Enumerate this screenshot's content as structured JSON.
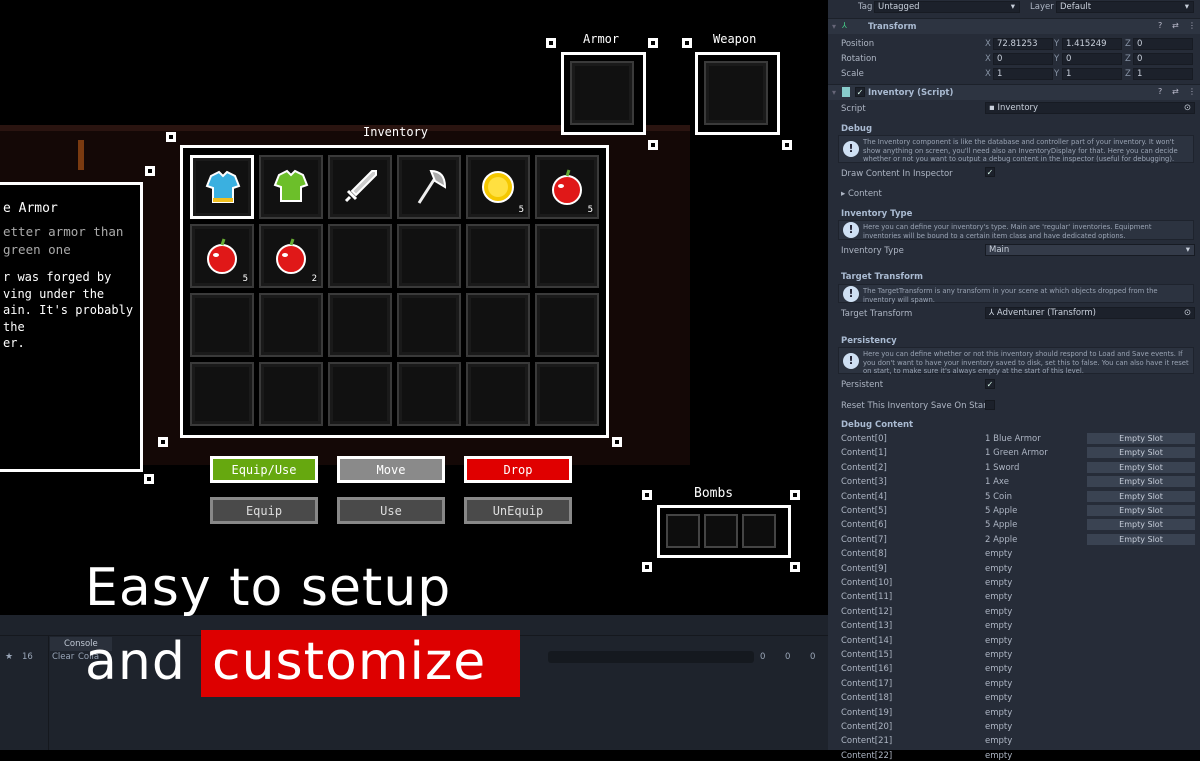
{
  "game": {
    "inventory_title": "Inventory",
    "armor_title": "Armor",
    "weapon_title": "Weapon",
    "bombs_title": "Bombs",
    "description": {
      "title": "e Armor",
      "short": [
        "etter armor than",
        "green one"
      ],
      "long": [
        "r was forged by",
        "ving under the",
        "ain. It's probably the",
        "er."
      ]
    },
    "slots": [
      {
        "icon": "blue-armor-icon",
        "count": ""
      },
      {
        "icon": "green-armor-icon",
        "count": ""
      },
      {
        "icon": "sword-icon",
        "count": ""
      },
      {
        "icon": "axe-icon",
        "count": ""
      },
      {
        "icon": "coin-icon",
        "count": "5"
      },
      {
        "icon": "apple-icon",
        "count": "5"
      },
      {
        "icon": "apple-icon",
        "count": "5"
      },
      {
        "icon": "apple-icon",
        "count": "2"
      }
    ],
    "buttons": {
      "equip_use": "Equip/Use",
      "move": "Move",
      "drop": "Drop",
      "equip": "Equip",
      "use": "Use",
      "unequip": "UnEquip"
    },
    "colors": {
      "equip_use": "#66a80f",
      "move": "#8a8a8a",
      "drop": "#e00000",
      "highlight": "#dd0000"
    }
  },
  "overlay": {
    "line1": "Easy to setup",
    "line2_plain": "and",
    "line2_highlight": "customize"
  },
  "console": {
    "tab": "Console",
    "clear": "Clear",
    "collapse": "Colla",
    "hidden_count": "16",
    "errors": "0",
    "warnings": "0",
    "logs": "0"
  },
  "inspector": {
    "tag_label": "Tag",
    "tag_value": "Untagged",
    "layer_label": "Layer",
    "layer_value": "Default",
    "transform": {
      "title": "Transform",
      "rows": [
        {
          "label": "Position",
          "x": "72.81253",
          "y": "1.415249",
          "z": "0"
        },
        {
          "label": "Rotation",
          "x": "0",
          "y": "0",
          "z": "0"
        },
        {
          "label": "Scale",
          "x": "1",
          "y": "1",
          "z": "1"
        }
      ]
    },
    "script_component": {
      "title": "Inventory (Script)",
      "script_label": "Script",
      "script_value": "Inventory"
    },
    "debug": {
      "title": "Debug",
      "help": "The Inventory component is like the database and controller part of your inventory. It won't show anything on screen, you'll need also an InventoryDisplay for that. Here you can decide whether or not you want to output a debug content in the inspector (useful for debugging).",
      "draw_label": "Draw Content In Inspector",
      "draw_checked": true,
      "content_label": "Content"
    },
    "inventory_type": {
      "title": "Inventory Type",
      "help": "Here you can define your inventory's type. Main are 'regular' inventories. Equipment inventories will be bound to a certain item class and have dedicated options.",
      "label": "Inventory Type",
      "value": "Main"
    },
    "target_transform": {
      "title": "Target Transform",
      "help": "The TargetTransform is any transform in your scene at which objects dropped from the inventory will spawn.",
      "label": "Target Transform",
      "value": "Adventurer (Transform)"
    },
    "persistency": {
      "title": "Persistency",
      "help": "Here you can define whether or not this inventory should respond to Load and Save events. If you don't want to have your inventory saved to disk, set this to false. You can also have it reset on start, to make sure it's always empty at the start of this level.",
      "persistent_label": "Persistent",
      "persistent_checked": true,
      "reset_label": "Reset This Inventory Save On Start",
      "reset_checked": false
    },
    "debug_content": {
      "title": "Debug Content",
      "button": "Empty Slot",
      "rows": [
        [
          "Content[0]",
          "1 Blue Armor"
        ],
        [
          "Content[1]",
          "1 Green Armor"
        ],
        [
          "Content[2]",
          "1 Sword"
        ],
        [
          "Content[3]",
          "1 Axe"
        ],
        [
          "Content[4]",
          "5 Coin"
        ],
        [
          "Content[5]",
          "5 Apple"
        ],
        [
          "Content[6]",
          "5 Apple"
        ],
        [
          "Content[7]",
          "2 Apple"
        ],
        [
          "Content[8]",
          "empty"
        ],
        [
          "Content[9]",
          "empty"
        ],
        [
          "Content[10]",
          "empty"
        ],
        [
          "Content[11]",
          "empty"
        ],
        [
          "Content[12]",
          "empty"
        ],
        [
          "Content[13]",
          "empty"
        ],
        [
          "Content[14]",
          "empty"
        ],
        [
          "Content[15]",
          "empty"
        ],
        [
          "Content[16]",
          "empty"
        ],
        [
          "Content[17]",
          "empty"
        ],
        [
          "Content[18]",
          "empty"
        ],
        [
          "Content[19]",
          "empty"
        ],
        [
          "Content[20]",
          "empty"
        ],
        [
          "Content[21]",
          "empty"
        ],
        [
          "Content[22]",
          "empty"
        ]
      ]
    }
  }
}
